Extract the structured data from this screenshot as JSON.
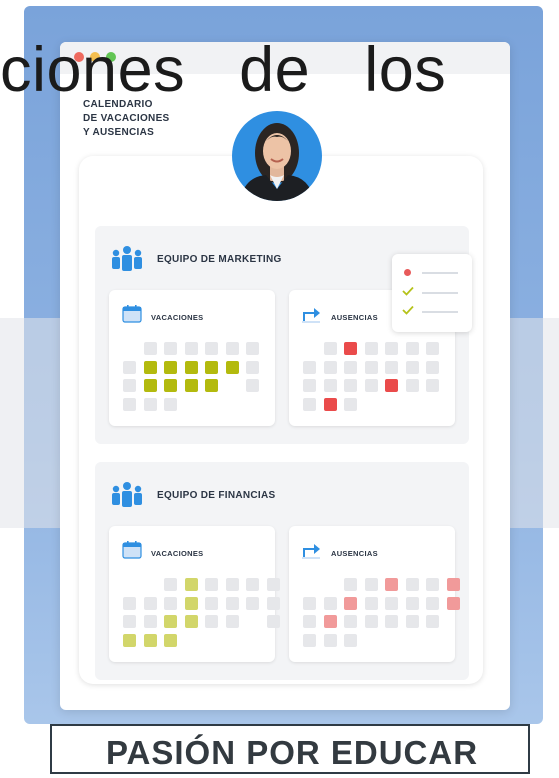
{
  "overlay_heading": "ciones   de   los",
  "app": {
    "brand_lines": [
      "CALENDARIO",
      "DE VACACIONES",
      "Y AUSENCIAS"
    ]
  },
  "teams": [
    {
      "title": "EQUIPO DE MARKETING",
      "panels": [
        {
          "label": "VACACIONES",
          "icon": "calendar-icon"
        },
        {
          "label": "AUSENCIAS",
          "icon": "arrow-return-icon"
        }
      ]
    },
    {
      "title": "EQUIPO DE FINANCIAS",
      "panels": [
        {
          "label": "VACACIONES",
          "icon": "calendar-icon"
        },
        {
          "label": "AUSENCIAS",
          "icon": "arrow-return-icon"
        }
      ]
    }
  ],
  "checklist": {
    "items": [
      {
        "marker": "dot",
        "color": "#e85a5a"
      },
      {
        "marker": "check",
        "color": "#b5c21a"
      },
      {
        "marker": "check",
        "color": "#b5c21a"
      }
    ]
  },
  "colors": {
    "vacation": "#b3ba0e",
    "vacation_light": "#d2d66a",
    "absence": "#ea4b4b",
    "absence_light": "#f19a9a",
    "team_icon": "#2f8fe1",
    "cell_empty": "#e6e7ea"
  },
  "footer": {
    "text": "PASIÓN POR EDUCAR"
  }
}
